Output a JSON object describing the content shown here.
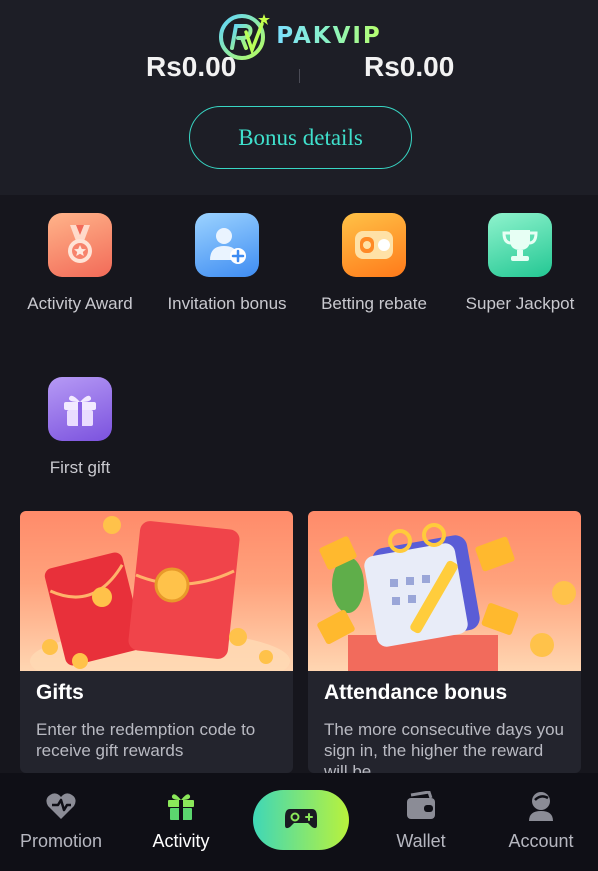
{
  "app": {
    "brand": "PAKVIP"
  },
  "header": {
    "balance_left": "Rs0.00",
    "balance_right": "Rs0.00",
    "bonus_button": "Bonus details"
  },
  "activities": [
    {
      "label": "Activity Award",
      "icon": "medal-icon"
    },
    {
      "label": "Invitation bonus",
      "icon": "add-user-icon"
    },
    {
      "label": "Betting rebate",
      "icon": "wallet-rebate-icon"
    },
    {
      "label": "Super Jackpot",
      "icon": "trophy-icon"
    },
    {
      "label": "First gift",
      "icon": "gift-icon"
    }
  ],
  "cards": [
    {
      "title": "Gifts",
      "description": "Enter the redemption code to receive gift rewards",
      "image": "red-envelope-illustration"
    },
    {
      "title": "Attendance bonus",
      "description": "The more consecutive days you sign in, the higher the reward will be.",
      "image": "calendar-illustration"
    }
  ],
  "bottom_nav": {
    "items": [
      {
        "label": "Promotion",
        "icon": "promotion-icon"
      },
      {
        "label": "Activity",
        "icon": "gift-icon",
        "active": true
      },
      {
        "label": "Wallet",
        "icon": "wallet-icon"
      },
      {
        "label": "Account",
        "icon": "account-icon"
      }
    ],
    "center_icon": "gamepad-icon"
  },
  "colors": {
    "accent": "#3fe0cc",
    "background": "#16161d",
    "nav_gradient_start": "#3fd7b7",
    "nav_gradient_end": "#b9f23c"
  }
}
